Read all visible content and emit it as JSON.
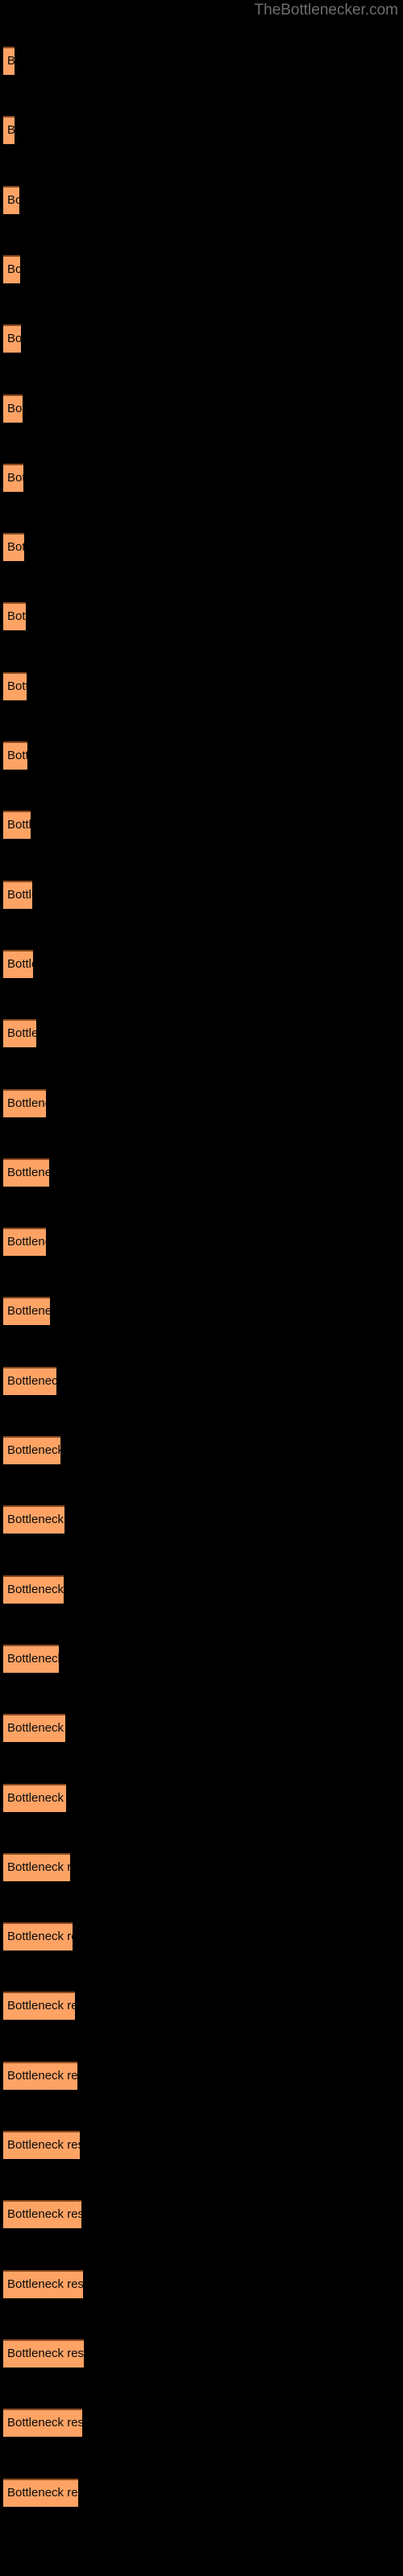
{
  "site": {
    "title": "TheBottlenecker.com",
    "title_color": "#6e6e6e"
  },
  "colors": {
    "background": "#000000",
    "bar_fill": "#ffa365",
    "bar_top_edge": "#8a4a20",
    "label_text": "#0a0a0a"
  },
  "bar_label": "Bottleneck result",
  "chart_data": {
    "type": "bar",
    "orientation": "horizontal",
    "title": "TheBottlenecker.com",
    "xlabel": "",
    "ylabel": "",
    "grid": false,
    "legend": false,
    "categories": [
      "Bottleneck result",
      "Bottleneck result",
      "Bottleneck result",
      "Bottleneck result",
      "Bottleneck result",
      "Bottleneck result",
      "Bottleneck result",
      "Bottleneck result",
      "Bottleneck result",
      "Bottleneck result",
      "Bottleneck result",
      "Bottleneck result",
      "Bottleneck result",
      "Bottleneck result",
      "Bottleneck result",
      "Bottleneck result",
      "Bottleneck result",
      "Bottleneck result",
      "Bottleneck result",
      "Bottleneck result",
      "Bottleneck result",
      "Bottleneck result",
      "Bottleneck result",
      "Bottleneck result",
      "Bottleneck result",
      "Bottleneck result",
      "Bottleneck result",
      "Bottleneck result",
      "Bottleneck result",
      "Bottleneck result",
      "Bottleneck result",
      "Bottleneck result",
      "Bottleneck result",
      "Bottleneck result",
      "Bottleneck result",
      "Bottleneck result"
    ],
    "values": [
      14,
      14,
      20,
      21,
      22,
      24,
      25,
      26,
      28,
      29,
      30,
      34,
      36,
      37,
      41,
      53,
      57,
      53,
      58,
      66,
      71,
      76,
      75,
      69,
      77,
      78,
      83,
      86,
      89,
      92,
      95,
      97,
      99,
      100,
      98,
      93
    ],
    "bar_pixel_widths": [
      14,
      14,
      20,
      21,
      22,
      24,
      25,
      26,
      28,
      29,
      30,
      34,
      36,
      37,
      41,
      53,
      57,
      53,
      58,
      66,
      71,
      76,
      75,
      69,
      77,
      78,
      83,
      86,
      89,
      92,
      95,
      97,
      99,
      100,
      98,
      93
    ],
    "xlim": [
      0,
      100
    ],
    "bar_count": 36
  }
}
